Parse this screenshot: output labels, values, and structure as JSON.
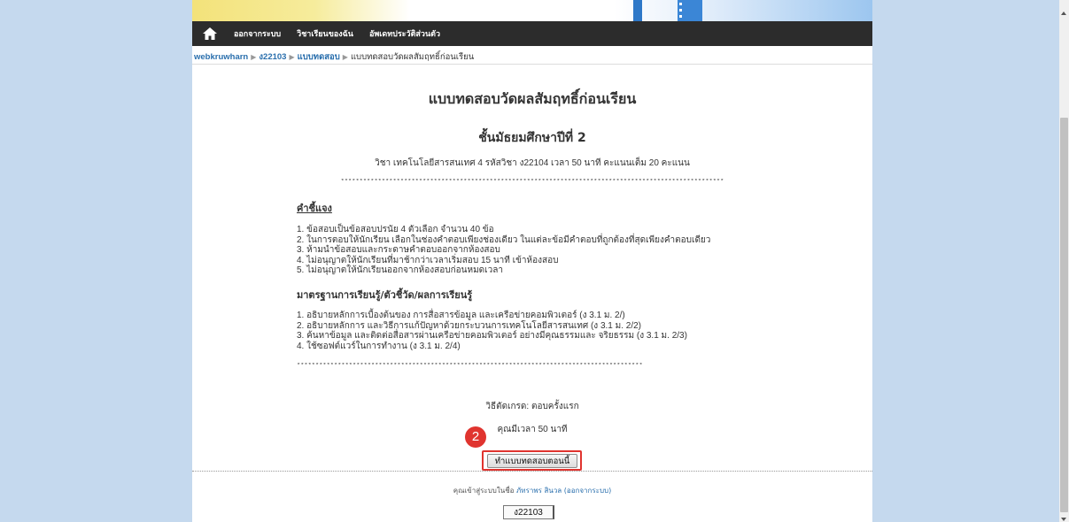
{
  "nav": {
    "items": [
      "ออกจากระบบ",
      "วิชาเรียนของฉัน",
      "อัพเดทประวัติส่วนตัว"
    ]
  },
  "breadcrumb": {
    "items": [
      "webkruwharn",
      "ง22103",
      "แบบทดสอบ",
      "แบบทดสอบวัดผลสัมฤทธิ์ก่อนเรียน"
    ]
  },
  "quiz": {
    "title": "แบบทดสอบวัดผลสัมฤทธิ์ก่อนเรียน",
    "grade_heading": "ชั้นมัธยมศึกษาปีที่ 2",
    "course_info": "วิชา เทคโนโลยีสารสนเทศ 4 รหัสวิชา ง22104 เวลา 50 นาที คะแนนเต็ม 20 คะแนน",
    "stars_top": "*******************************************************************************************************",
    "instructions_heading": "คำชี้แจง",
    "instructions": [
      "1. ข้อสอบเป็นข้อสอบปรนัย 4 ตัวเลือก จำนวน 40 ข้อ",
      "2. ในการตอบให้นักเรียน เลือกในช่องคำตอบเพียงช่องเดียว ในแต่ละข้อมีคำตอบที่ถูกต้องที่สุดเพียงคำตอบเดียว",
      "3. ห้ามนำข้อสอบและกระดาษคำตอบออกจากห้องสอบ",
      "4. ไม่อนุญาตให้นักเรียนที่มาช้ากว่าเวลาเริ่มสอบ 15 นาที เข้าห้องสอบ",
      "5. ไม่อนุญาตให้นักเรียนออกจากห้องสอบก่อนหมดเวลา"
    ],
    "standards_heading": "มาตรฐานการเรียนรู้/ตัวชี้วัด/ผลการเรียนรู้",
    "standards": [
      "1. อธิบายหลักการเบื้องต้นของ การสื่อสารข้อมูล และเครือข่ายคอมพิวเตอร์ (ง 3.1 ม. 2/)",
      "2. อธิบายหลักการ และวิธีการแก้ปัญหาด้วยกระบวนการเทคโนโลยีสารสนเทศ (ง 3.1 ม. 2/2)",
      "3. ค้นหาข้อมูล และติดต่อสื่อสารผ่านเครือข่ายคอมพิวเตอร์ อย่างมีคุณธรรมและ จริยธรรม (ง 3.1 ม. 2/3)",
      "4. ใช้ซอฟต์แวร์ในการทำงาน (ง 3.1 ม. 2/4)"
    ],
    "stars_bottom": "*********************************************************************************************",
    "grade_method": "วิธีตัดเกรด: ตอบครั้งแรก",
    "time_limit": "คุณมีเวลา 50 นาที",
    "start_button": "ทำแบบทดสอบตอนนี้"
  },
  "annotation": {
    "step": "2",
    "color": "#e0342f"
  },
  "footer": {
    "login_prefix": "คุณเข้าสู่ระบบในชื่อ ",
    "user_name": "ภัทราพร สินวล",
    "logout_link": "(ออกจากระบบ)",
    "course_button": "ง22103"
  }
}
